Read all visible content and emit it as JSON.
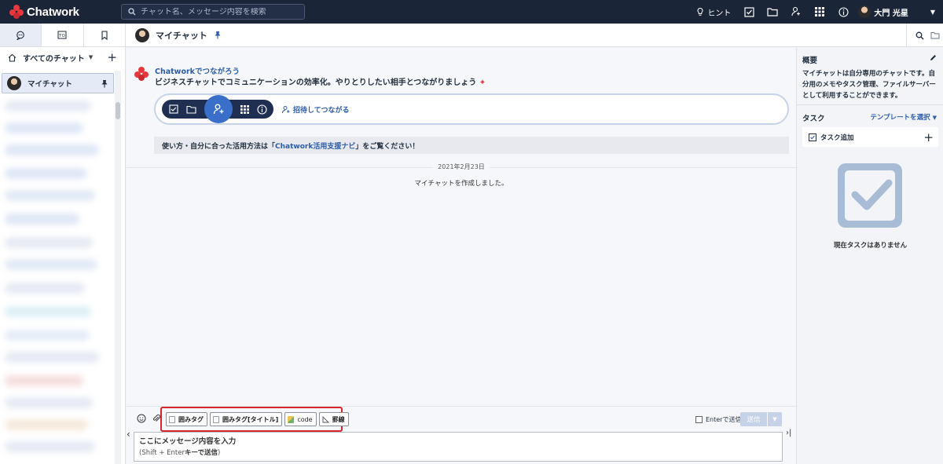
{
  "app": {
    "name": "Chatwork"
  },
  "topbar": {
    "search_placeholder": "チャット名、メッセージ内容を検索",
    "hint_label": "ヒント",
    "icons": [
      "lightbulb-icon",
      "task-check-icon",
      "folder-icon",
      "contacts-icon",
      "apps-grid-icon",
      "info-icon"
    ],
    "user_name": "大門 光星"
  },
  "sidebar": {
    "tabs": [
      "chat-bubble-icon",
      "mention-icon",
      "bookmark-icon"
    ],
    "filter_label": "すべてのチャット",
    "active_room": "マイチャット"
  },
  "chat": {
    "title": "マイチャット",
    "welcome_label": "Chatworkでつながろう",
    "welcome_title": "ビジネスチャットでコミュニケーションの効率化。やりとりしたい相手とつながりましょう",
    "invite_label": "招待してつながる",
    "tip_prefix": "使い方・自分に合った活用方法は「",
    "tip_link": "Chatwork活用支援ナビ",
    "tip_suffix": "」をご覧ください！",
    "date": "2021年2月23日",
    "system_message": "マイチャットを作成しました。"
  },
  "composer": {
    "tag_buttons": [
      "囲みタグ",
      "囲みタグ[タイトル]",
      "code",
      "罫線"
    ],
    "enter_send_label": "Enterで送信",
    "send_label": "送信",
    "placeholder_line1": "ここにメッセージ内容を入力",
    "placeholder_line2_prefix": "(Shift + Enter",
    "placeholder_line2_bold": "キーで送信",
    "placeholder_line2_suffix": ")"
  },
  "right_panel": {
    "overview_title": "概要",
    "overview_desc": "マイチャットは自分専用のチャットです。自分用のメモやタスク管理、ファイルサーバーとして利用することができます。",
    "task_title": "タスク",
    "template_label": "テンプレートを選択",
    "task_add_label": "タスク追加",
    "empty_label": "現在タスクはありません"
  },
  "colors": {
    "topbar": "#1b2538",
    "accent": "#2c5da8",
    "highlight_border": "#d7262c",
    "brand": "#e8383d"
  }
}
